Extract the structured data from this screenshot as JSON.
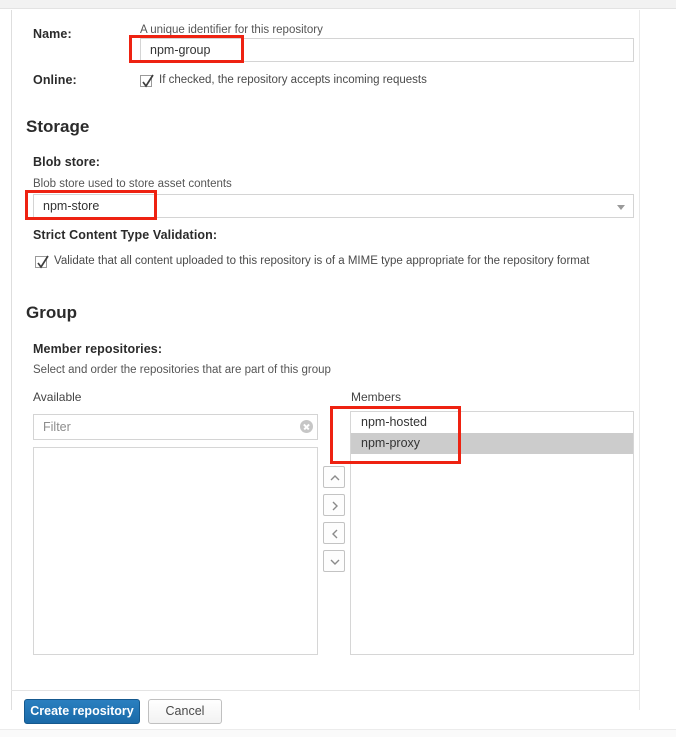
{
  "form": {
    "name_field": {
      "label": "Name:",
      "hint": "A unique identifier for this repository",
      "value": "npm-group",
      "placeholder": ""
    },
    "online_field": {
      "label": "Online:",
      "checkbox_text": "If checked, the repository accepts incoming requests",
      "checked": true
    }
  },
  "storage": {
    "section_title": "Storage",
    "blob_store": {
      "label": "Blob store:",
      "hint": "Blob store used to store asset contents",
      "value": "npm-store"
    },
    "strict_validation": {
      "label": "Strict Content Type Validation:",
      "checkbox_text": "Validate that all content uploaded to this repository is of a MIME type appropriate for the repository format",
      "checked": true
    }
  },
  "group": {
    "section_title": "Group",
    "member_repositories": {
      "label": "Member repositories:",
      "hint": "Select and order the repositories that are part of this group"
    },
    "available": {
      "header": "Available",
      "filter_placeholder": "Filter",
      "filter_value": "",
      "clear_icon": "clear-circle-icon",
      "items": []
    },
    "members": {
      "header": "Members",
      "items": [
        {
          "label": "npm-hosted",
          "selected": false
        },
        {
          "label": "npm-proxy",
          "selected": true
        }
      ]
    },
    "transfer_buttons": [
      {
        "icon": "chevron-up-icon",
        "name": "move-up-button"
      },
      {
        "icon": "chevron-right-icon",
        "name": "add-to-members-button"
      },
      {
        "icon": "chevron-left-icon",
        "name": "remove-from-members-button"
      },
      {
        "icon": "chevron-down-icon",
        "name": "move-down-button"
      }
    ]
  },
  "actions": {
    "create_label": "Create repository",
    "cancel_label": "Cancel"
  },
  "colors": {
    "primary_button": "#1a6aa8",
    "annotation": "#ee2211",
    "selected_row": "#cccccc"
  }
}
